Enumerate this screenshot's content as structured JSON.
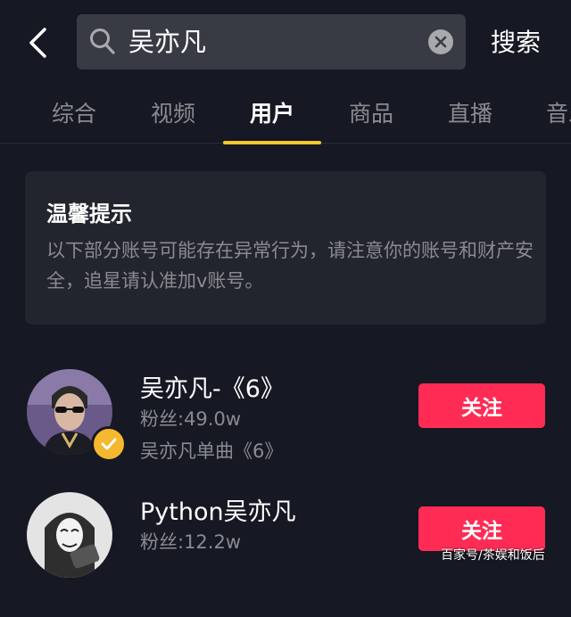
{
  "header": {
    "back_icon": "chevron-left-icon",
    "search_query": "吴亦凡",
    "search_button_label": "搜索"
  },
  "tabs": [
    {
      "label": "综合",
      "active": false
    },
    {
      "label": "视频",
      "active": false
    },
    {
      "label": "用户",
      "active": true
    },
    {
      "label": "商品",
      "active": false
    },
    {
      "label": "直播",
      "active": false
    },
    {
      "label": "音乐",
      "active": false
    }
  ],
  "notice": {
    "title": "温馨提示",
    "body": "以下部分账号可能存在异常行为，请注意你的账号和财产安全，追星请认准加v账号。"
  },
  "users": [
    {
      "name": "吴亦凡-《6》",
      "fans": "粉丝:49.0w",
      "desc": "吴亦凡单曲《6》",
      "verified": true,
      "follow_label": "关注"
    },
    {
      "name": "Python吴亦凡",
      "fans": "粉丝:12.2w",
      "desc": "",
      "verified": false,
      "follow_label": "关注"
    }
  ],
  "watermark": "百家号/茶娱和饭后",
  "colors": {
    "background": "#161823",
    "search_box": "#393b44",
    "tab_indicator": "#f5c630",
    "follow_button": "#fe2c55",
    "verified_badge": "#f5b82e"
  }
}
